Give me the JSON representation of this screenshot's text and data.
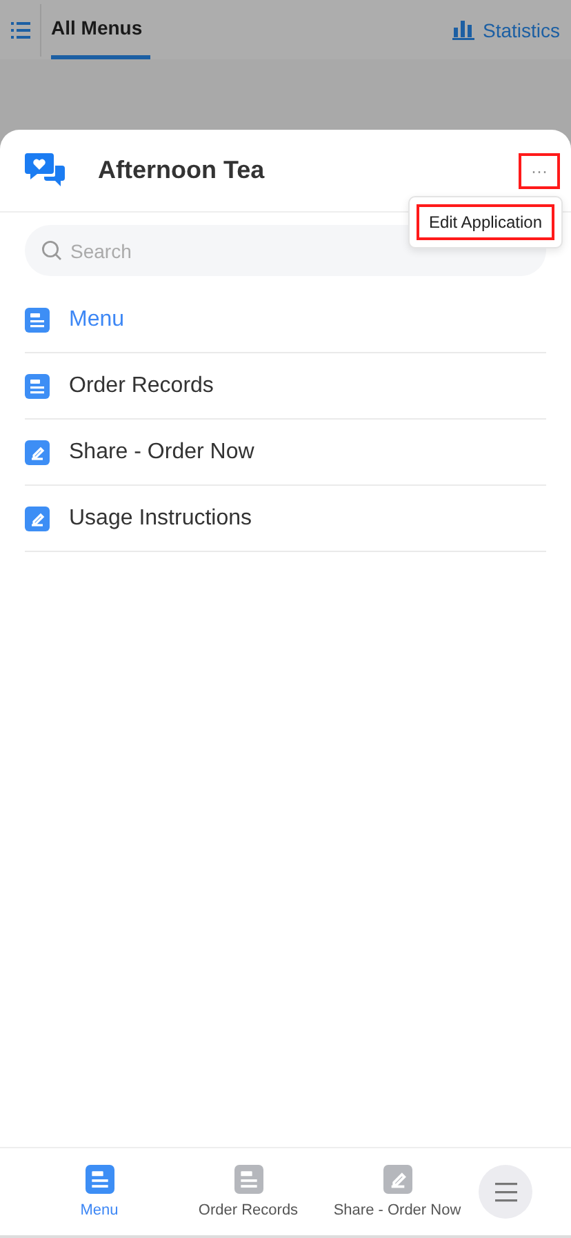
{
  "top_bar": {
    "tab": {
      "label": "All Menus",
      "selected": true
    },
    "statistics_link": "Statistics"
  },
  "sheet": {
    "title": "Afternoon Tea",
    "more_button": {
      "label": "···",
      "highlighted": true
    },
    "popup_menu": [
      {
        "label": "Edit Application",
        "highlighted": true
      }
    ],
    "search": {
      "placeholder": "Search"
    },
    "items": [
      {
        "label": "Menu",
        "kind": "list",
        "selected": true
      },
      {
        "label": "Order Records",
        "kind": "list",
        "selected": false
      },
      {
        "label": "Share - Order Now",
        "kind": "edit",
        "selected": false
      },
      {
        "label": "Usage Instructions",
        "kind": "edit",
        "selected": false
      }
    ]
  },
  "bottom_nav": [
    {
      "label": "Menu",
      "kind": "list",
      "selected": true
    },
    {
      "label": "Order Records",
      "kind": "list",
      "selected": false
    },
    {
      "label": "Share - Order Now",
      "kind": "edit",
      "selected": false
    }
  ]
}
